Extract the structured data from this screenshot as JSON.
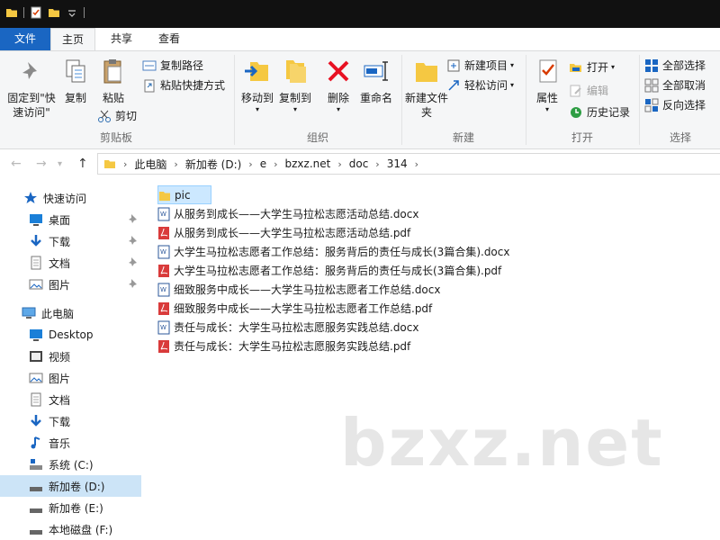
{
  "ribbon_tabs": {
    "file": "文件",
    "home": "主页",
    "share": "共享",
    "view": "查看"
  },
  "clipboard": {
    "pin_quick": "固定到\"快速访问\"",
    "copy": "复制",
    "paste": "粘贴",
    "copy_path": "复制路径",
    "paste_shortcut": "粘贴快捷方式",
    "cut": "剪切",
    "group": "剪贴板"
  },
  "organize": {
    "move_to": "移动到",
    "copy_to": "复制到",
    "delete": "删除",
    "rename": "重命名",
    "group": "组织"
  },
  "new_group": {
    "new_folder": "新建文件夹",
    "new_item": "新建项目",
    "easy_access": "轻松访问",
    "group": "新建"
  },
  "open_group": {
    "properties": "属性",
    "open": "打开",
    "edit": "编辑",
    "history": "历史记录",
    "group": "打开"
  },
  "select_group": {
    "select_all": "全部选择",
    "select_none": "全部取消",
    "invert": "反向选择",
    "group": "选择"
  },
  "breadcrumb": [
    "此电脑",
    "新加卷 (D:)",
    "e",
    "bzxz.net",
    "doc",
    "314"
  ],
  "sidebar": {
    "quick_access": "快速访问",
    "quick_items": [
      "桌面",
      "下载",
      "文档",
      "图片"
    ],
    "this_pc": "此电脑",
    "pc_items": [
      "Desktop",
      "视频",
      "图片",
      "文档",
      "下载",
      "音乐",
      "系统 (C:)",
      "新加卷 (D:)",
      "新加卷 (E:)",
      "本地磁盘 (F:)"
    ]
  },
  "files": [
    {
      "name": "pic",
      "type": "folder"
    },
    {
      "name": "从服务到成长——大学生马拉松志愿活动总结.docx",
      "type": "docx"
    },
    {
      "name": "从服务到成长——大学生马拉松志愿活动总结.pdf",
      "type": "pdf"
    },
    {
      "name": "大学生马拉松志愿者工作总结：服务背后的责任与成长(3篇合集).docx",
      "type": "docx"
    },
    {
      "name": "大学生马拉松志愿者工作总结：服务背后的责任与成长(3篇合集).pdf",
      "type": "pdf"
    },
    {
      "name": "细致服务中成长——大学生马拉松志愿者工作总结.docx",
      "type": "docx"
    },
    {
      "name": "细致服务中成长——大学生马拉松志愿者工作总结.pdf",
      "type": "pdf"
    },
    {
      "name": "责任与成长：大学生马拉松志愿服务实践总结.docx",
      "type": "docx"
    },
    {
      "name": "责任与成长：大学生马拉松志愿服务实践总结.pdf",
      "type": "pdf"
    }
  ],
  "watermark": "bzxz.net"
}
